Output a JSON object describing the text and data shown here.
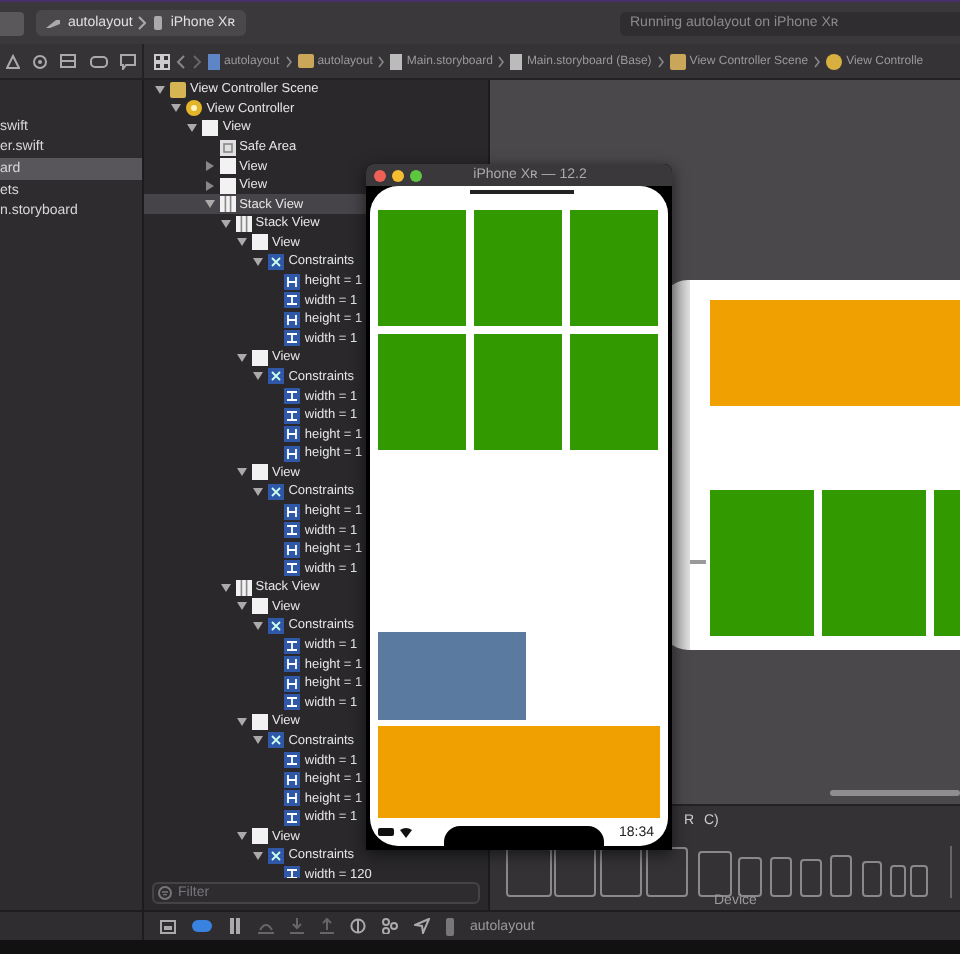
{
  "toolbar": {
    "scheme": "autolayout",
    "device": "iPhone Xʀ",
    "status": "Running autolayout on iPhone Xʀ"
  },
  "jump_bar": [
    {
      "label": "autolayout",
      "kind": "project"
    },
    {
      "label": "autolayout",
      "kind": "folder"
    },
    {
      "label": "Main.storyboard",
      "kind": "file"
    },
    {
      "label": "Main.storyboard (Base)",
      "kind": "file"
    },
    {
      "label": "View Controller Scene",
      "kind": "scene"
    },
    {
      "label": "View Controlle",
      "kind": "controller"
    }
  ],
  "navigator": {
    "items": [
      {
        "label": "swift",
        "selected": false
      },
      {
        "label": "er.swift",
        "selected": false
      },
      {
        "label": "ard",
        "selected": true
      },
      {
        "label": "ets",
        "selected": false
      },
      {
        "label": "n.storyboard",
        "selected": false
      }
    ]
  },
  "outline": {
    "tree": [
      {
        "label": "View Controller Scene",
        "kind": "scene",
        "expanded": true,
        "selected": false,
        "children": [
          {
            "label": "View Controller",
            "kind": "controller",
            "expanded": true,
            "selected": false,
            "children": [
              {
                "label": "View",
                "kind": "view",
                "expanded": true,
                "selected": false,
                "children": [
                  {
                    "label": "Safe Area",
                    "kind": "safe-area",
                    "selected": false
                  },
                  {
                    "label": "View",
                    "kind": "view",
                    "expanded": false,
                    "selected": false
                  },
                  {
                    "label": "View",
                    "kind": "view",
                    "expanded": false,
                    "selected": false
                  },
                  {
                    "label": "Stack View",
                    "kind": "stack",
                    "expanded": true,
                    "selected": true,
                    "children": [
                      {
                        "label": "Stack View",
                        "kind": "stack",
                        "expanded": true,
                        "selected": false,
                        "children": [
                          {
                            "label": "View",
                            "kind": "view",
                            "expanded": true,
                            "selected": false,
                            "children": [
                              {
                                "label": "Constraints",
                                "kind": "constraints",
                                "expanded": true,
                                "selected": false,
                                "children": [
                                  {
                                    "label": "height = 1",
                                    "kind": "height",
                                    "selected": false
                                  },
                                  {
                                    "label": "width = 1",
                                    "kind": "width",
                                    "selected": false
                                  },
                                  {
                                    "label": "height = 1",
                                    "kind": "height",
                                    "selected": false
                                  },
                                  {
                                    "label": "width = 1",
                                    "kind": "width",
                                    "selected": false
                                  }
                                ]
                              }
                            ]
                          },
                          {
                            "label": "View",
                            "kind": "view",
                            "expanded": true,
                            "selected": false,
                            "children": [
                              {
                                "label": "Constraints",
                                "kind": "constraints",
                                "expanded": true,
                                "selected": false,
                                "children": [
                                  {
                                    "label": "width = 1",
                                    "kind": "width",
                                    "selected": false
                                  },
                                  {
                                    "label": "width = 1",
                                    "kind": "width",
                                    "selected": false
                                  },
                                  {
                                    "label": "height = 1",
                                    "kind": "height",
                                    "selected": false
                                  },
                                  {
                                    "label": "height = 1",
                                    "kind": "height",
                                    "selected": false
                                  }
                                ]
                              }
                            ]
                          },
                          {
                            "label": "View",
                            "kind": "view",
                            "expanded": true,
                            "selected": false,
                            "children": [
                              {
                                "label": "Constraints",
                                "kind": "constraints",
                                "expanded": true,
                                "selected": false,
                                "children": [
                                  {
                                    "label": "height = 1",
                                    "kind": "height",
                                    "selected": false
                                  },
                                  {
                                    "label": "width = 1",
                                    "kind": "width",
                                    "selected": false
                                  },
                                  {
                                    "label": "height = 1",
                                    "kind": "height",
                                    "selected": false
                                  },
                                  {
                                    "label": "width = 1",
                                    "kind": "width",
                                    "selected": false
                                  }
                                ]
                              }
                            ]
                          }
                        ]
                      },
                      {
                        "label": "Stack View",
                        "kind": "stack",
                        "expanded": true,
                        "selected": false,
                        "children": [
                          {
                            "label": "View",
                            "kind": "view",
                            "expanded": true,
                            "selected": false,
                            "children": [
                              {
                                "label": "Constraints",
                                "kind": "constraints",
                                "expanded": true,
                                "selected": false,
                                "children": [
                                  {
                                    "label": "width = 1",
                                    "kind": "width",
                                    "selected": false
                                  },
                                  {
                                    "label": "height = 1",
                                    "kind": "height",
                                    "selected": false
                                  },
                                  {
                                    "label": "height = 1",
                                    "kind": "height",
                                    "selected": false
                                  },
                                  {
                                    "label": "width = 1",
                                    "kind": "width",
                                    "selected": false
                                  }
                                ]
                              }
                            ]
                          },
                          {
                            "label": "View",
                            "kind": "view",
                            "expanded": true,
                            "selected": false,
                            "children": [
                              {
                                "label": "Constraints",
                                "kind": "constraints",
                                "expanded": true,
                                "selected": false,
                                "children": [
                                  {
                                    "label": "width = 1",
                                    "kind": "width",
                                    "selected": false
                                  },
                                  {
                                    "label": "height = 1",
                                    "kind": "height",
                                    "selected": false
                                  },
                                  {
                                    "label": "height = 1",
                                    "kind": "height",
                                    "selected": false
                                  },
                                  {
                                    "label": "width = 1",
                                    "kind": "width",
                                    "selected": false
                                  }
                                ]
                              }
                            ]
                          },
                          {
                            "label": "View",
                            "kind": "view",
                            "expanded": true,
                            "selected": false,
                            "children": [
                              {
                                "label": "Constraints",
                                "kind": "constraints",
                                "expanded": true,
                                "selected": false,
                                "children": [
                                  {
                                    "label": "width = 120",
                                    "kind": "width",
                                    "selected": false
                                  }
                                ]
                              }
                            ]
                          }
                        ]
                      }
                    ]
                  }
                ]
              }
            ]
          }
        ]
      }
    ],
    "filter": {
      "placeholder": "Filter"
    }
  },
  "simulator": {
    "title": "iPhone Xʀ — 12.2",
    "time": "18:34"
  },
  "device_bar": {
    "width_class": "R",
    "height_class": "C)",
    "label": "Device"
  },
  "debug_bar": {
    "target": "autolayout"
  }
}
